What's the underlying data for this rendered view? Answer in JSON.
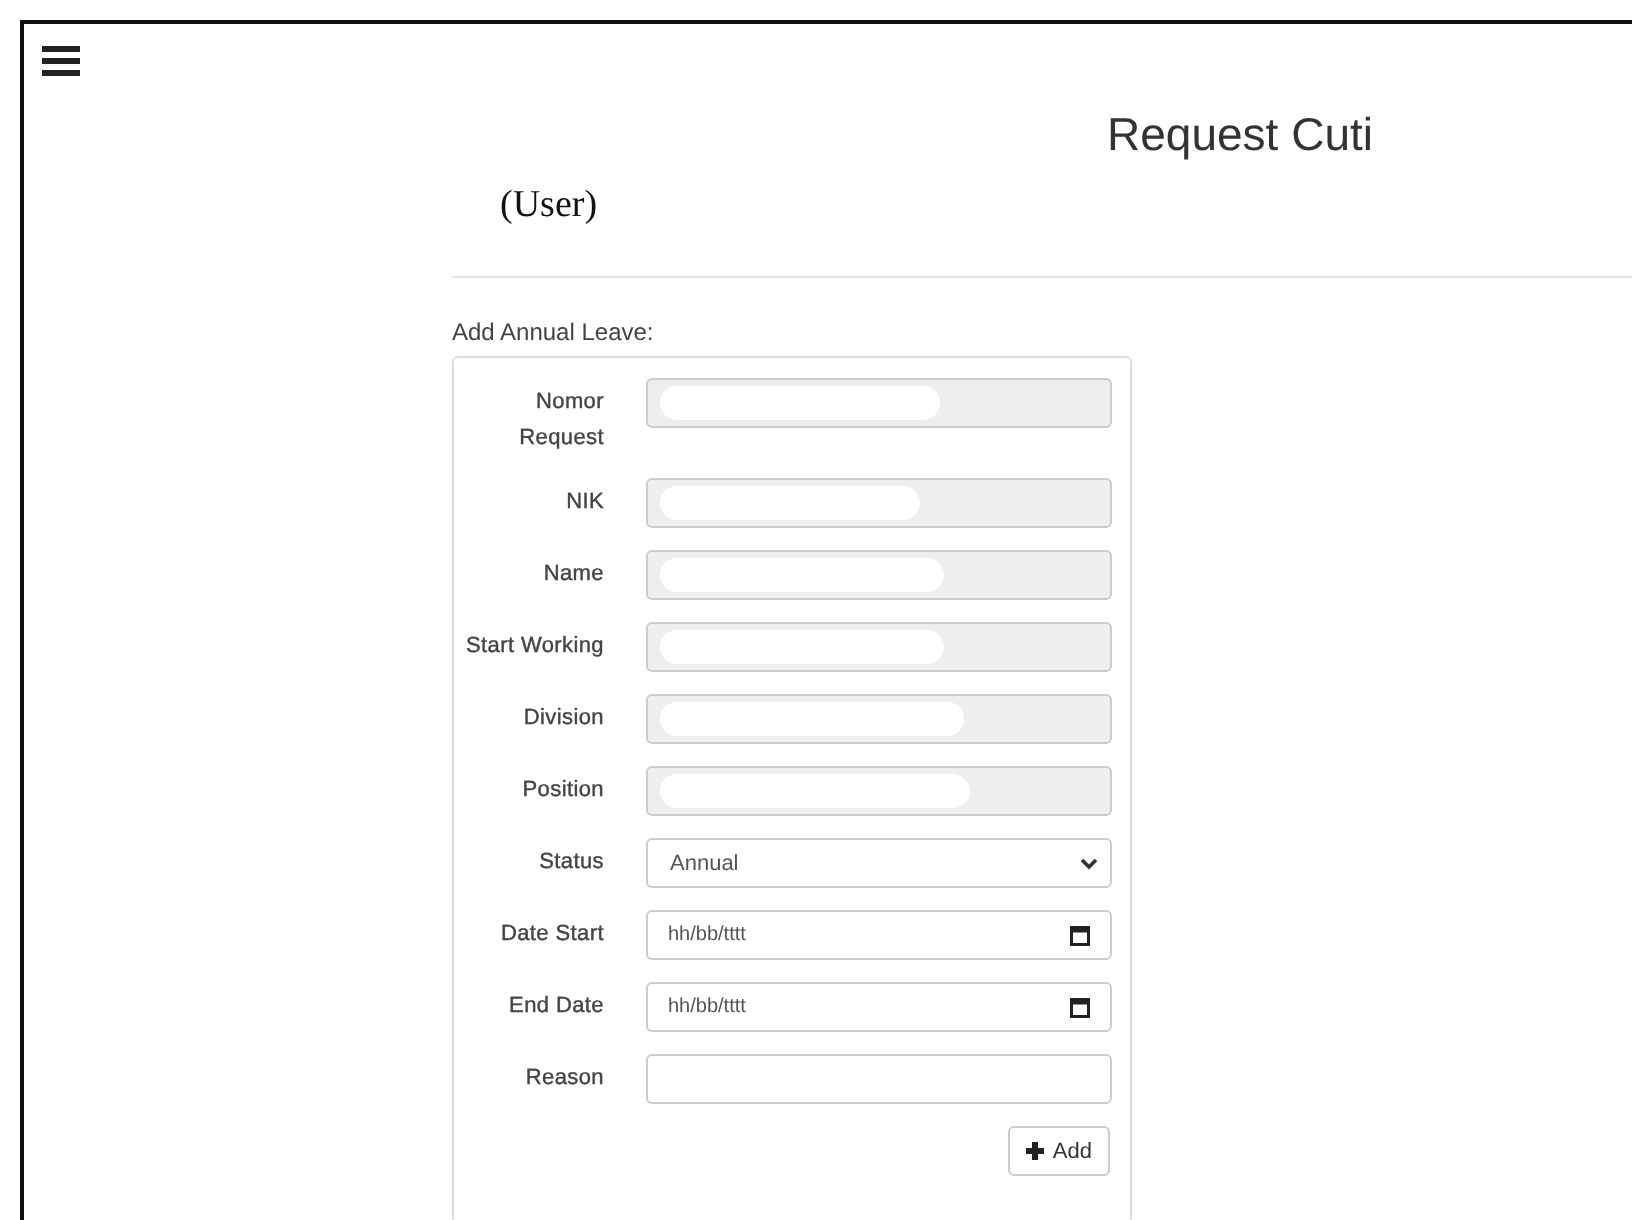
{
  "header": {
    "user": "(User)",
    "title": "Request Cuti"
  },
  "form": {
    "heading": "Add Annual Leave:",
    "fields": [
      {
        "label": "Nomor Request",
        "kind": "readonly",
        "redacted": true
      },
      {
        "label": "NIK",
        "kind": "readonly",
        "redacted": true
      },
      {
        "label": "Name",
        "kind": "readonly",
        "redacted": true
      },
      {
        "label": "Start Working",
        "kind": "readonly",
        "redacted": true
      },
      {
        "label": "Division",
        "kind": "readonly",
        "redacted": true
      },
      {
        "label": "Position",
        "kind": "readonly",
        "redacted": true
      },
      {
        "label": "Status",
        "kind": "select",
        "value": "Annual"
      },
      {
        "label": "Date Start",
        "kind": "date",
        "placeholder": "hh/bb/tttt"
      },
      {
        "label": "End Date",
        "kind": "date",
        "placeholder": "hh/bb/tttt"
      },
      {
        "label": "Reason",
        "kind": "text"
      }
    ],
    "button": "Add"
  }
}
